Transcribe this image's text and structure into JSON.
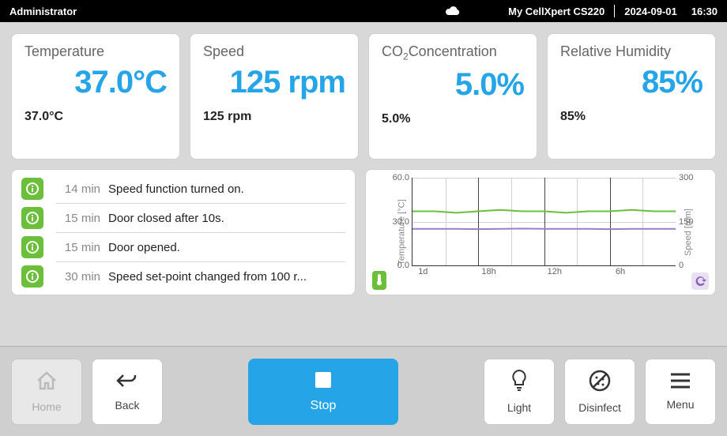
{
  "statusbar": {
    "user": "Administrator",
    "device": "My CellXpert CS220",
    "date": "2024-09-01",
    "time": "16:30"
  },
  "cards": [
    {
      "title": "Temperature",
      "value": "37.0°C",
      "setpoint": "37.0°C"
    },
    {
      "title": "Speed",
      "value": "125 rpm",
      "setpoint": "125 rpm"
    },
    {
      "title": "CO2Concentration",
      "value": "5.0%",
      "setpoint": "5.0%"
    },
    {
      "title": "Relative Humidity",
      "value": "85%",
      "setpoint": "85%"
    }
  ],
  "events": [
    {
      "time": "14 min",
      "msg": "Speed function turned on."
    },
    {
      "time": "15 min",
      "msg": "Door closed after 10s."
    },
    {
      "time": "15 min",
      "msg": "Door opened."
    },
    {
      "time": "30 min",
      "msg": "Speed set-point changed from 100 r..."
    }
  ],
  "chart": {
    "ylabel_left": "Temperature [°C]",
    "ylabel_right": "Speed [rpm]",
    "yticks_left": [
      "0.0",
      "30.0",
      "60.0"
    ],
    "yticks_right": [
      "0",
      "150",
      "300"
    ],
    "xticks": [
      "1d",
      "18h",
      "12h",
      "6h"
    ],
    "temp_badge_icon": "thermometer-icon",
    "speed_badge_icon": "refresh-icon"
  },
  "chart_data": {
    "type": "line",
    "x": [
      "-24h",
      "-22h",
      "-20h",
      "-18h",
      "-16h",
      "-14h",
      "-12h",
      "-10h",
      "-8h",
      "-6h",
      "-4h",
      "-2h",
      "0h"
    ],
    "series": [
      {
        "name": "Temperature [°C]",
        "axis": "left",
        "color": "#6bbf3a",
        "values": [
          37,
          37,
          36,
          37,
          38,
          37,
          37,
          36,
          37,
          37,
          38,
          37,
          37
        ]
      },
      {
        "name": "Speed [rpm]",
        "axis": "right",
        "color": "#9a7fc4",
        "values": [
          125,
          125,
          125,
          124,
          125,
          126,
          125,
          125,
          125,
          124,
          125,
          125,
          125
        ]
      }
    ],
    "ylim_left": [
      0,
      60
    ],
    "ylim_right": [
      0,
      300
    ],
    "xticks": [
      "1d",
      "18h",
      "12h",
      "6h"
    ]
  },
  "toolbar": {
    "home": "Home",
    "back": "Back",
    "stop": "Stop",
    "light": "Light",
    "disinfect": "Disinfect",
    "menu": "Menu"
  }
}
